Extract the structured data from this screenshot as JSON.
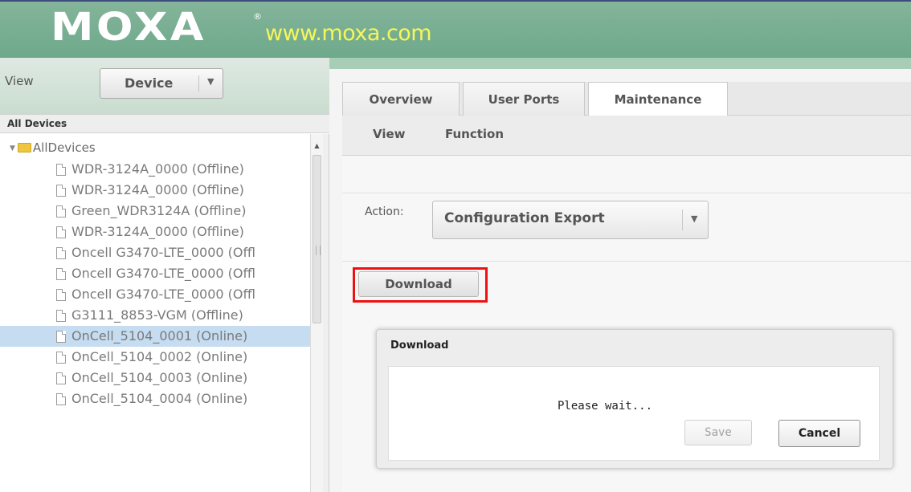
{
  "header": {
    "logo_text": "MOXA",
    "logo_registered": "®",
    "url_text": "www.moxa.com",
    "colors": {
      "header_green": "#7aaf94",
      "url_yellow": "#f6f65a",
      "highlight_red": "#ee1111",
      "selection_blue": "#c5dcf1"
    }
  },
  "left_panel": {
    "view_label": "View",
    "view_select_value": "Device",
    "section_title": "All Devices",
    "tree_root": "AllDevices",
    "devices": [
      {
        "label": "WDR-3124A_0000 (Offline)",
        "selected": false
      },
      {
        "label": "WDR-3124A_0000 (Offline)",
        "selected": false
      },
      {
        "label": "Green_WDR3124A (Offline)",
        "selected": false
      },
      {
        "label": "WDR-3124A_0000 (Offline)",
        "selected": false
      },
      {
        "label": "Oncell G3470-LTE_0000 (Offl",
        "selected": false
      },
      {
        "label": "Oncell G3470-LTE_0000 (Offl",
        "selected": false
      },
      {
        "label": "Oncell G3470-LTE_0000 (Offl",
        "selected": false
      },
      {
        "label": "G3111_8853-VGM (Offline)",
        "selected": false
      },
      {
        "label": "OnCell_5104_0001 (Online)",
        "selected": true
      },
      {
        "label": "OnCell_5104_0002 (Online)",
        "selected": false
      },
      {
        "label": "OnCell_5104_0003 (Online)",
        "selected": false
      },
      {
        "label": "OnCell_5104_0004 (Online)",
        "selected": false
      }
    ]
  },
  "main": {
    "tabs": [
      {
        "label": "Overview",
        "active": false
      },
      {
        "label": "User Ports",
        "active": false
      },
      {
        "label": "Maintenance",
        "active": true
      }
    ],
    "subtabs": [
      {
        "label": "View"
      },
      {
        "label": "Function"
      }
    ],
    "action_label": "Action:",
    "action_value": "Configuration Export",
    "download_button": "Download"
  },
  "dialog": {
    "title": "Download",
    "message": "Please wait...",
    "save_button": "Save",
    "cancel_button": "Cancel"
  }
}
